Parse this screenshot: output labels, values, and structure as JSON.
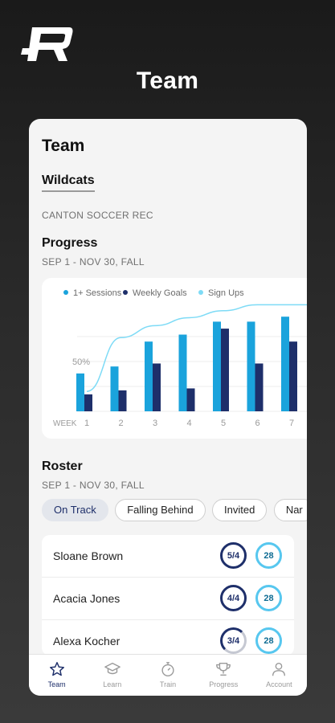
{
  "app": {
    "title": "Team"
  },
  "card": {
    "title": "Team",
    "team_name": "Wildcats",
    "organization": "CANTON SOCCER REC"
  },
  "progress": {
    "title": "Progress",
    "date_range": "SEP 1 - NOV 30, FALL"
  },
  "chart_data": {
    "type": "bar",
    "legend_position": "top",
    "categories": [
      "1",
      "2",
      "3",
      "4",
      "5",
      "6",
      "7"
    ],
    "x_prefix_label": "WEEK",
    "y_tick_label": "50%",
    "series": [
      {
        "name": "1+ Sessions",
        "kind": "bar",
        "color": "#1aa3dc",
        "values": [
          0.38,
          0.45,
          0.7,
          0.77,
          0.9,
          0.9,
          0.95
        ]
      },
      {
        "name": "Weekly Goals",
        "kind": "bar",
        "color": "#1e2f6a",
        "values": [
          0.17,
          0.21,
          0.48,
          0.23,
          0.83,
          0.48,
          0.7
        ]
      },
      {
        "name": "Sign Ups",
        "kind": "line",
        "color": "#7edbf6",
        "values": [
          0.2,
          0.74,
          0.86,
          0.94,
          1.01,
          1.07,
          1.07
        ]
      }
    ]
  },
  "roster": {
    "title": "Roster",
    "date_range": "SEP 1 - NOV 30, FALL",
    "filters": [
      {
        "label": "On Track",
        "active": true
      },
      {
        "label": "Falling Behind",
        "active": false
      },
      {
        "label": "Invited",
        "active": false
      },
      {
        "label": "Nar",
        "active": false
      }
    ],
    "players": [
      {
        "name": "Sloane Brown",
        "goals": "5/4",
        "sessions": "28"
      },
      {
        "name": "Acacia Jones",
        "goals": "4/4",
        "sessions": "28"
      },
      {
        "name": "Alexa Kocher",
        "goals": "3/4",
        "sessions": "28"
      }
    ]
  },
  "nav": {
    "tabs": [
      {
        "label": "Team",
        "icon": "star-icon",
        "active": true
      },
      {
        "label": "Learn",
        "icon": "graduation-cap-icon",
        "active": false
      },
      {
        "label": "Train",
        "icon": "stopwatch-icon",
        "active": false
      },
      {
        "label": "Progress",
        "icon": "trophy-icon",
        "active": false
      },
      {
        "label": "Account",
        "icon": "person-icon",
        "active": false
      }
    ]
  },
  "colors": {
    "navy": "#1e2f6a",
    "sky": "#1aa3dc",
    "light_cyan": "#7edbf6"
  }
}
